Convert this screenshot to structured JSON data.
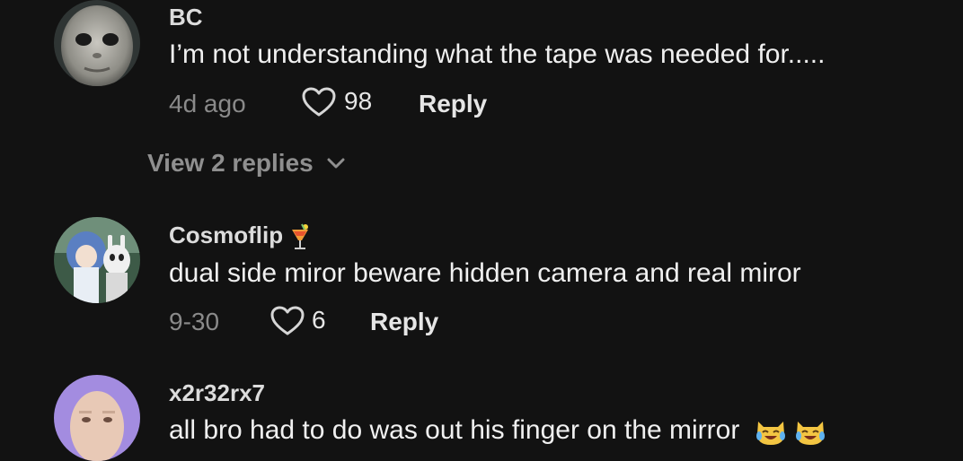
{
  "comments": [
    {
      "username": "BC",
      "text": "I’m not understanding what the tape was needed for.....",
      "date": "4d ago",
      "likes": "98",
      "reply_label": "Reply",
      "avatar": "alien-face-avatar"
    },
    {
      "username": "Cosmoflip",
      "username_emoji": "tropical-drink-icon",
      "text": "dual side miror beware hidden camera and real miror",
      "date": "9-30",
      "likes": "6",
      "reply_label": "Reply",
      "avatar": "anime-characters-avatar"
    },
    {
      "username": "x2r32rx7",
      "text": "all bro had to do was out his finger on the mirror",
      "text_emojis": [
        "cat-laughing-tears-icon",
        "cat-laughing-tears-icon"
      ],
      "avatar": "person-face-purple-avatar"
    }
  ],
  "view_replies": {
    "label": "View 2 replies",
    "icon": "chevron-down-icon"
  },
  "colors": {
    "background": "#121212",
    "primary_text": "#f0f0f0",
    "secondary_text": "#8a8a8a",
    "accent_purple": "#a38ce0"
  }
}
